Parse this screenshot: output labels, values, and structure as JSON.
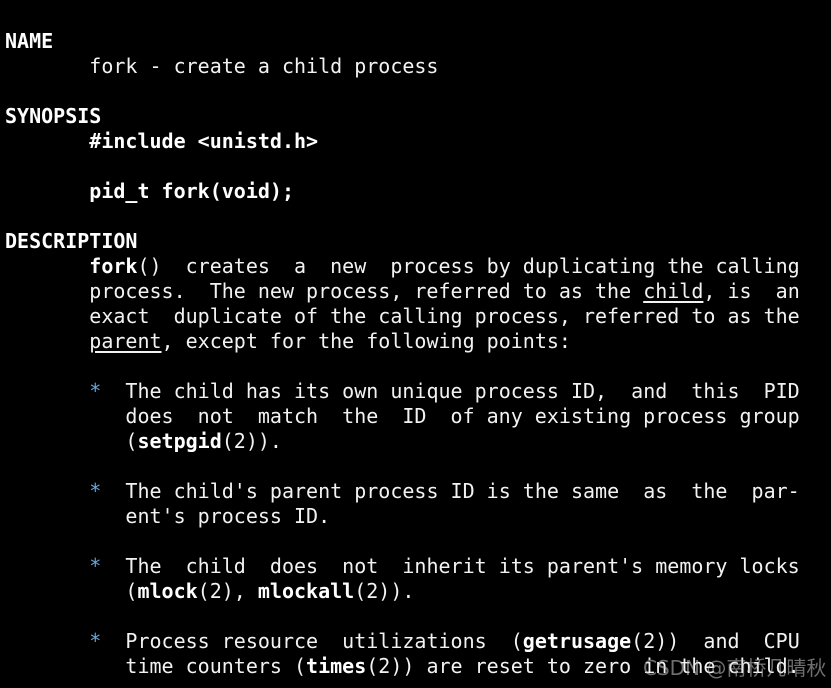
{
  "terminal": {
    "colors": {
      "background": "#000000",
      "text": "#f2f2f2",
      "bullet": "#6aa6d6"
    },
    "lines": [
      [
        {
          "t": "NAME",
          "s": "b"
        }
      ],
      [
        {
          "t": "       fork - create a child process"
        }
      ],
      [],
      [
        {
          "t": "SYNOPSIS",
          "s": "b"
        }
      ],
      [
        {
          "t": "       "
        },
        {
          "t": "#include <unistd.h>",
          "s": "b"
        }
      ],
      [],
      [
        {
          "t": "       "
        },
        {
          "t": "pid_t fork(void);",
          "s": "b"
        }
      ],
      [],
      [
        {
          "t": "DESCRIPTION",
          "s": "b"
        }
      ],
      [
        {
          "t": "       "
        },
        {
          "t": "fork",
          "s": "b"
        },
        {
          "t": "()  creates  a  new  process by duplicating the calling"
        }
      ],
      [
        {
          "t": "       process.  The new process, referred to as the "
        },
        {
          "t": "child",
          "s": "u"
        },
        {
          "t": ", is  an"
        }
      ],
      [
        {
          "t": "       exact  duplicate of the calling process, referred to as the"
        }
      ],
      [
        {
          "t": "       "
        },
        {
          "t": "parent",
          "s": "u"
        },
        {
          "t": ", except for the following points:"
        }
      ],
      [],
      [
        {
          "t": "       "
        },
        {
          "t": "*",
          "s": "c"
        },
        {
          "t": "  The child has its own unique process ID,  and  this  PID"
        }
      ],
      [
        {
          "t": "          does  not  match  the  ID  of any existing process group"
        }
      ],
      [
        {
          "t": "          ("
        },
        {
          "t": "setpgid",
          "s": "b"
        },
        {
          "t": "(2))."
        }
      ],
      [],
      [
        {
          "t": "       "
        },
        {
          "t": "*",
          "s": "c"
        },
        {
          "t": "  The child's parent process ID is the same  as  the  par-"
        }
      ],
      [
        {
          "t": "          ent's process ID."
        }
      ],
      [],
      [
        {
          "t": "       "
        },
        {
          "t": "*",
          "s": "c"
        },
        {
          "t": "  The  child  does  not  inherit its parent's memory locks"
        }
      ],
      [
        {
          "t": "          ("
        },
        {
          "t": "mlock",
          "s": "b"
        },
        {
          "t": "(2), "
        },
        {
          "t": "mlockall",
          "s": "b"
        },
        {
          "t": "(2))."
        }
      ],
      [],
      [
        {
          "t": "       "
        },
        {
          "t": "*",
          "s": "c"
        },
        {
          "t": "  Process resource  utilizations  ("
        },
        {
          "t": "getrusage",
          "s": "b"
        },
        {
          "t": "(2))  and  CPU"
        }
      ],
      [
        {
          "t": "          time counters ("
        },
        {
          "t": "times",
          "s": "b"
        },
        {
          "t": "(2)) are reset to zero in the child."
        }
      ]
    ]
  },
  "watermark": "CSDN @南桥几晴秋"
}
